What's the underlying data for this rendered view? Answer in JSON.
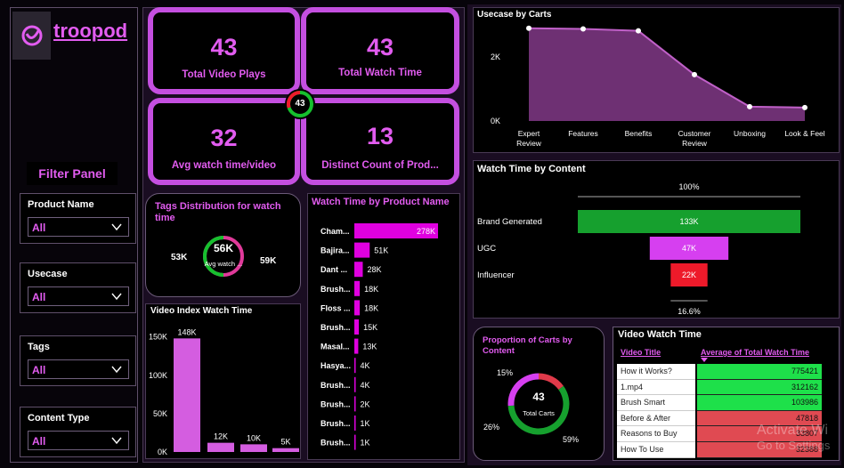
{
  "brand": {
    "name": "troopod",
    "accent": "#e25cf0"
  },
  "filter_panel": {
    "title": "Filter Panel",
    "filters": [
      {
        "label": "Product Name",
        "value": "All"
      },
      {
        "label": "Usecase",
        "value": "All"
      },
      {
        "label": "Tags",
        "value": "All"
      },
      {
        "label": "Content Type",
        "value": "All"
      }
    ]
  },
  "kpis": {
    "total_video_plays": {
      "value": "43",
      "label": "Total Video Plays"
    },
    "total_watch_time": {
      "value": "43",
      "label": "Total Watch Time"
    },
    "avg_watch_time": {
      "value": "32",
      "label": "Avg watch time/video"
    },
    "distinct_products": {
      "value": "13",
      "label": "Distinct Count of Prod..."
    },
    "center_value": "43"
  },
  "tags": {
    "title": "Tags Distribution for watch time",
    "center_value": "56K",
    "center_label": "Avg watch ...",
    "left_label": "53K",
    "right_label": "59K"
  },
  "product_watch": {
    "title": "Watch Time by Product Name",
    "color": "#e000e0",
    "max": 278,
    "items": [
      {
        "name": "Cham...",
        "value": 278,
        "label": "278K"
      },
      {
        "name": "Bajira...",
        "value": 51,
        "label": "51K"
      },
      {
        "name": "Dant ...",
        "value": 28,
        "label": "28K"
      },
      {
        "name": "Brush...",
        "value": 18,
        "label": "18K"
      },
      {
        "name": "Floss ...",
        "value": 18,
        "label": "18K"
      },
      {
        "name": "Brush...",
        "value": 15,
        "label": "15K"
      },
      {
        "name": "Masal...",
        "value": 13,
        "label": "13K"
      },
      {
        "name": "Hasya...",
        "value": 4,
        "label": "4K"
      },
      {
        "name": "Brush...",
        "value": 4,
        "label": "4K"
      },
      {
        "name": "Brush...",
        "value": 2,
        "label": "2K"
      },
      {
        "name": "Brush...",
        "value": 1,
        "label": "1K"
      },
      {
        "name": "Brush...",
        "value": 1,
        "label": "1K"
      }
    ]
  },
  "video_index": {
    "title": "Video Index Watch Time",
    "color": "#d45de0",
    "yticks": [
      "150K",
      "100K",
      "50K",
      "0K"
    ],
    "tick_values": [
      150,
      100,
      50,
      0
    ],
    "max": 160,
    "bars": [
      {
        "value": 148,
        "label": "148K"
      },
      {
        "value": 12,
        "label": "12K"
      },
      {
        "value": 10,
        "label": "10K"
      },
      {
        "value": 5,
        "label": "5K"
      }
    ]
  },
  "usecase": {
    "title": "Usecase by Carts",
    "yticks": [
      "2K",
      "0K"
    ],
    "tick_values": [
      2,
      0
    ],
    "max": 3.2,
    "categories": [
      "Expert Review",
      "Features",
      "Benefits",
      "Customer Review",
      "Unboxing",
      "Look & Feel"
    ],
    "values": [
      2.9,
      2.88,
      2.82,
      1.45,
      0.45,
      0.42
    ],
    "color": "#a040a8"
  },
  "watch_by_content": {
    "title": "Watch Time by Content",
    "top_label": "100%",
    "bottom_label": "16.6%",
    "max": 133,
    "items": [
      {
        "name": "Brand Generated",
        "value": 133,
        "label": "133K",
        "color": "#16a02e"
      },
      {
        "name": "UGC",
        "value": 47,
        "label": "47K",
        "color": "#d63ff0"
      },
      {
        "name": "Influencer",
        "value": 22,
        "label": "22K",
        "color": "#ee1a2a"
      }
    ]
  },
  "carts_proportion": {
    "title": "Proportion of Carts by Content",
    "center_value": "43",
    "center_label": "Total Carts",
    "slices": [
      {
        "label": "59%",
        "value": 59,
        "color": "#16a02e"
      },
      {
        "label": "26%",
        "value": 26,
        "color": "#d63ff0"
      },
      {
        "label": "15%",
        "value": 15,
        "color": "#e03a4a"
      }
    ]
  },
  "video_table": {
    "title": "Video Watch Time",
    "col_title": "Video Title",
    "col_value": "Average of Total Watch Time",
    "rows": [
      {
        "title": "How it Works?",
        "value": "775421",
        "color": "#1ee04a"
      },
      {
        "title": "1.mp4",
        "value": "312162",
        "color": "#1ee04a"
      },
      {
        "title": "Brush Smart",
        "value": "103986",
        "color": "#1ee04a"
      },
      {
        "title": "Before & After",
        "value": "47818",
        "color": "#e04a52"
      },
      {
        "title": "Reasons to Buy",
        "value": "33807",
        "color": "#e04a52"
      },
      {
        "title": "How To Use",
        "value": "32388",
        "color": "#e04a52"
      }
    ]
  },
  "watermark": {
    "line1": "Activate Wi",
    "line2": "Go to Settings"
  }
}
